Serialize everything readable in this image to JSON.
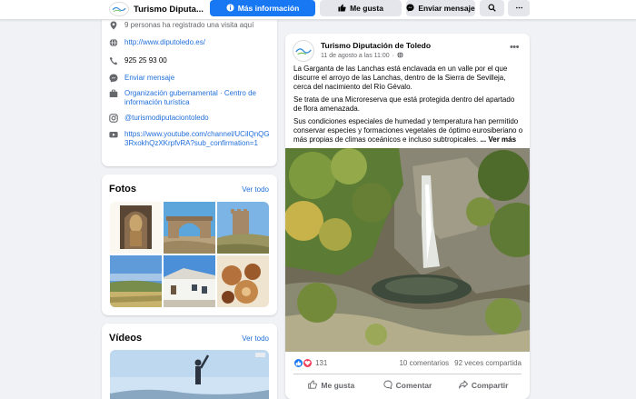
{
  "topbar": {
    "page_name": "Turismo Diputa...",
    "more_info_button": "Más información",
    "like_button": "Me gusta",
    "message_button": "Enviar mensaje"
  },
  "about": {
    "visits": "9 personas ha registrado una visita aquí",
    "website": "http://www.diputoledo.es/",
    "phone": "925 25 93 00",
    "send_message": "Enviar mensaje",
    "category": "Organización gubernamental · Centro de información turística",
    "instagram": "@turismodiputaciontoledo",
    "youtube": "https://www.youtube.com/channel/UCilQnQG3RxokhQzXKrpfvRA?sub_confirmation=1"
  },
  "photos": {
    "title": "Fotos",
    "see_all": "Ver todo"
  },
  "videos": {
    "title": "Vídeos",
    "see_all": "Ver todo"
  },
  "post": {
    "author": "Turismo Diputación de Toledo",
    "date": "11 de agosto a las 11:00",
    "paragraph1": "La Garganta de las Lanchas está enclavada en un valle por el que discurre el arroyo de las Lanchas, dentro de la Sierra de Sevilleja, cerca del nacimiento del Río Gévalo.",
    "paragraph2": "Se trata de una Microreserva que está protegida dentro del apartado de flora amenazada.",
    "paragraph3": "Sus condiciones especiales de humedad y temperatura han permitido conservar especies y formaciones vegetales de óptimo eurosiberiano o más propias de climas oceánicos e incluso subtropicales.",
    "see_more": "... Ver más",
    "reaction_count": "131",
    "comments": "10 comentarios",
    "shares": "92 veces compartida",
    "like_action": "Me gusta",
    "comment_action": "Comentar",
    "share_action": "Compartir"
  },
  "colors": {
    "primary": "#1877f2",
    "link": "#216fdb",
    "background": "#f0f2f5",
    "secondary_text": "#65676b"
  },
  "icons": [
    "check-in-icon",
    "globe-icon",
    "phone-icon",
    "messenger-icon",
    "briefcase-icon",
    "instagram-icon",
    "youtube-icon",
    "info-icon",
    "thumbs-up-icon",
    "search-icon",
    "more-icon",
    "public-icon",
    "comment-icon",
    "share-icon",
    "love-reaction-icon"
  ]
}
